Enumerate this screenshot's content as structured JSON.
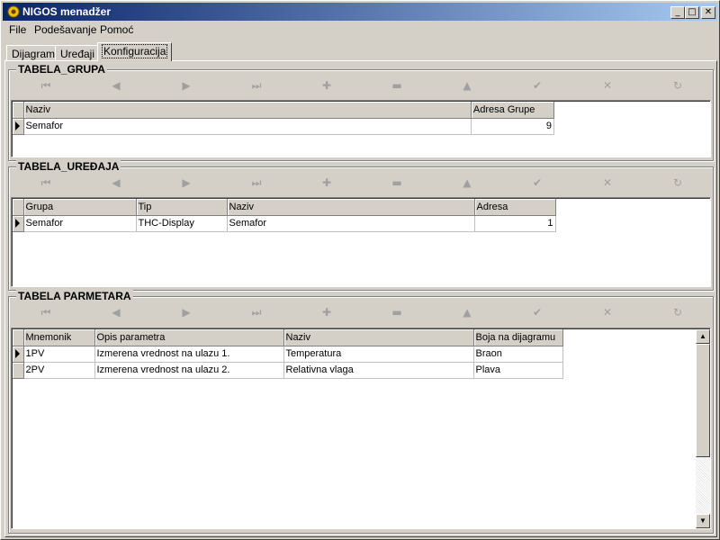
{
  "window": {
    "title": "NIGOS menadžer",
    "min_icon": "minimize-icon",
    "max_icon": "maximize-icon",
    "close_icon": "close-icon"
  },
  "menu": [
    "File",
    "Podešavanje",
    "Pomoć"
  ],
  "tabs": [
    "Dijagram",
    "Uređaji",
    "Konfiguracija"
  ],
  "active_tab": "Konfiguracija",
  "navigator_icons": [
    "first-record-icon",
    "prior-record-icon",
    "next-record-icon",
    "last-record-icon",
    "insert-icon",
    "delete-icon",
    "edit-icon",
    "post-icon",
    "cancel-icon",
    "refresh-icon"
  ],
  "navigator_glyphs": [
    "⏮",
    "◀",
    "▶",
    "⏭",
    "✚",
    "▬",
    "▲",
    "✔",
    "✕",
    "↻"
  ],
  "grupa": {
    "title": "TABELA_GRUPA",
    "columns": [
      "Naziv",
      "Adresa Grupe"
    ],
    "rows": [
      [
        "Semafor",
        "9"
      ]
    ]
  },
  "uredjaja": {
    "title": "TABELA_UREĐAJA",
    "columns": [
      "Grupa",
      "Tip",
      "Naziv",
      "Adresa"
    ],
    "rows": [
      [
        "Semafor",
        "THC-Display",
        "Semafor",
        "1"
      ]
    ]
  },
  "parametara": {
    "title": "TABELA PARMETARA",
    "columns": [
      "Mnemonik",
      "Opis parametra",
      "Naziv",
      "Boja na dijagramu"
    ],
    "rows": [
      [
        "1PV",
        "Izmerena vrednost na ulazu 1.",
        "Temperatura",
        "Braon"
      ],
      [
        "2PV",
        "Izmerena vrednost na ulazu 2.",
        "Relativna vlaga",
        "Plava"
      ]
    ]
  }
}
